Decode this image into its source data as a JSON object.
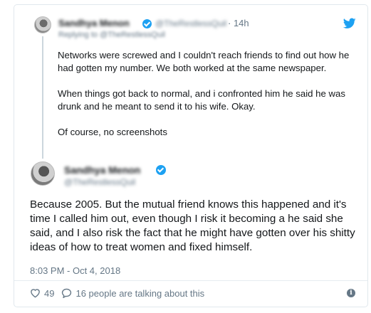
{
  "parent_tweet": {
    "author_name": "Sandhya Menon",
    "author_handle": "@TheRestlessQuil",
    "time": "· 14h",
    "replying_to": "Replying to @TheRestlessQuil",
    "paragraphs": [
      "Networks were screwed and I couldn't reach friends to find out how he had gotten my number. We both worked at the same newspaper.",
      "When things got back to normal, and i confronted him he said he was drunk and he meant to send it to his wife. Okay.",
      "Of course, no screenshots"
    ]
  },
  "main_tweet": {
    "author_name": "Sandhya Menon",
    "author_handle": "@TheRestlessQuil",
    "text": "Because 2005. But the mutual friend knows this happened and it's time I called him out, even though I risk it becoming a he said she said, and I also risk the fact that he might have gotten over his shitty ideas of how to treat women and fixed himself.",
    "timestamp": "8:03 PM - Oct 4, 2018",
    "likes": "49",
    "conversation": "16 people are talking about this"
  },
  "icons": {
    "brand": "twitter-bird-icon",
    "verified": "verified-badge-icon",
    "like": "heart-icon",
    "reply": "comment-bubble-icon",
    "info": "info-icon"
  },
  "colors": {
    "twitter_blue": "#1da1f2",
    "text": "#14171a",
    "muted": "#657786",
    "border": "#e1e8ed"
  }
}
